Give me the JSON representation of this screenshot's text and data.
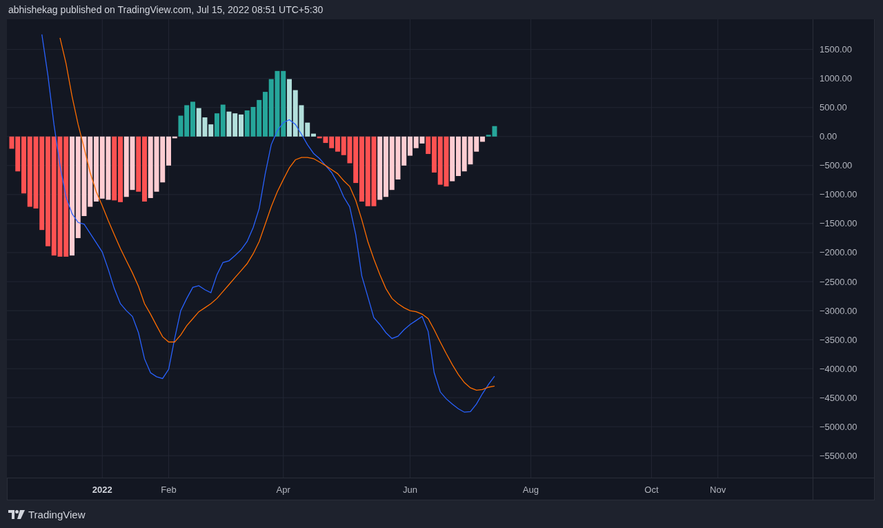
{
  "header": {
    "text": "abhishekag published on TradingView.com, Jul 15, 2022 08:51 UTC+5:30"
  },
  "histogram": {
    "chart_data": {
      "type": "bar",
      "categories": [
        null,
        null,
        null,
        null,
        null,
        null,
        null,
        null,
        null,
        null,
        null,
        null,
        null,
        null,
        null,
        "2022",
        null,
        null,
        null,
        null,
        null,
        null,
        null,
        null,
        null,
        null,
        "Feb",
        null,
        null,
        null,
        null,
        null,
        null,
        null,
        null,
        null,
        null,
        null,
        null,
        null,
        null,
        null,
        null,
        null,
        null,
        "Apr",
        null,
        null,
        null,
        null,
        null,
        null,
        null,
        null,
        null,
        null,
        null,
        null,
        null,
        null,
        null,
        null,
        null,
        null,
        null,
        null,
        "Jun",
        null,
        null,
        null,
        null,
        null,
        null,
        null,
        null,
        null,
        null,
        null,
        null,
        null,
        null,
        null,
        null,
        null,
        null,
        null,
        "Aug",
        null,
        null,
        null,
        null,
        null,
        null,
        null,
        null,
        null,
        null,
        null,
        null,
        null,
        null,
        null,
        null,
        null,
        null,
        null,
        "Oct",
        null,
        null,
        null,
        null,
        null,
        null,
        null,
        null,
        null,
        null,
        "Nov",
        null,
        null,
        null,
        null,
        null,
        null,
        null,
        null,
        null,
        null,
        null,
        null,
        null,
        null,
        null
      ],
      "ylim": [
        -6270,
        2020
      ],
      "yticks": [
        {
          "value": 1500,
          "label": "1500.00"
        },
        {
          "value": 1000,
          "label": "1000.00"
        },
        {
          "value": 500,
          "label": "500.00"
        },
        {
          "value": 0,
          "label": "0.00"
        },
        {
          "value": -500,
          "label": "−500.00"
        },
        {
          "value": -1000,
          "label": "−1000.00"
        },
        {
          "value": -1500,
          "label": "−1500.00"
        },
        {
          "value": -2000,
          "label": "−2000.00"
        },
        {
          "value": -2500,
          "label": "−2500.00"
        },
        {
          "value": -3000,
          "label": "−3000.00"
        },
        {
          "value": -3500,
          "label": "−3500.00"
        },
        {
          "value": -4000,
          "label": "−4000.00"
        },
        {
          "value": -4500,
          "label": "−4500.00"
        },
        {
          "value": -5000,
          "label": "−5000.00"
        },
        {
          "value": -5500,
          "label": "−5500.00"
        }
      ],
      "series": [
        {
          "color": "#ff5252",
          "values": [
            -210,
            -600,
            -980,
            -1210,
            -1240,
            -1610,
            -1890,
            -2050,
            -2070,
            -2070,
            null,
            null,
            null,
            null,
            null,
            null,
            null,
            -1100,
            -1130,
            null,
            null,
            -950,
            -1120,
            null,
            null,
            null,
            null,
            null,
            null,
            null,
            null,
            null,
            null,
            null,
            null,
            null,
            null,
            null,
            null,
            null,
            null,
            null,
            null,
            null,
            null,
            null,
            null,
            null,
            null,
            null,
            null,
            -30,
            -110,
            -200,
            -260,
            -320,
            -460,
            -800,
            -1120,
            -1200,
            -1200,
            null,
            null,
            null,
            null,
            null,
            null,
            null,
            null,
            -300,
            -620,
            -830,
            -860,
            null,
            null,
            null,
            null,
            null,
            null,
            null,
            null,
            null,
            null,
            null,
            null,
            null,
            null,
            null,
            null,
            null,
            null,
            null,
            null,
            null,
            null,
            null,
            null,
            null,
            null,
            null,
            null,
            null,
            null,
            null,
            null,
            null,
            null,
            null,
            null,
            null,
            null,
            null,
            null,
            null,
            null,
            null,
            null,
            null,
            null,
            null,
            null,
            null,
            null,
            null,
            null,
            null,
            null,
            null,
            null,
            null,
            null,
            null,
            null
          ]
        },
        {
          "color": "#ffcdd2",
          "values": [
            null,
            null,
            null,
            null,
            null,
            null,
            null,
            null,
            null,
            null,
            -2050,
            -1750,
            -1370,
            -1210,
            -1120,
            -1070,
            -1090,
            null,
            null,
            -1040,
            -920,
            null,
            null,
            -1060,
            -950,
            -790,
            -500,
            -30,
            null,
            null,
            null,
            null,
            null,
            null,
            null,
            null,
            null,
            null,
            null,
            null,
            null,
            null,
            null,
            null,
            null,
            null,
            null,
            null,
            null,
            null,
            null,
            null,
            null,
            null,
            null,
            null,
            null,
            null,
            null,
            null,
            null,
            -1090,
            -1040,
            -920,
            -740,
            -500,
            -330,
            -200,
            -120,
            null,
            null,
            null,
            null,
            -770,
            -680,
            -600,
            -480,
            -260,
            -90,
            null,
            null,
            null,
            null,
            null,
            null,
            null,
            null,
            null,
            null,
            null,
            null,
            null,
            null,
            null,
            null,
            null,
            null,
            null,
            null,
            null,
            null,
            null,
            null,
            null,
            null,
            null,
            null,
            null,
            null,
            null,
            null,
            null,
            null,
            null,
            null,
            null,
            null,
            null,
            null,
            null,
            null,
            null,
            null,
            null,
            null,
            null,
            null,
            null,
            null,
            null,
            null,
            null,
            null
          ]
        },
        {
          "color": "#26a69a",
          "values": [
            null,
            null,
            null,
            null,
            null,
            null,
            null,
            null,
            null,
            null,
            null,
            null,
            null,
            null,
            null,
            null,
            null,
            null,
            null,
            null,
            null,
            null,
            null,
            null,
            null,
            null,
            null,
            null,
            360,
            540,
            600,
            null,
            null,
            null,
            400,
            550,
            null,
            null,
            null,
            450,
            510,
            630,
            770,
            990,
            1130,
            1130,
            null,
            null,
            null,
            null,
            null,
            null,
            null,
            null,
            null,
            null,
            null,
            null,
            null,
            null,
            null,
            null,
            null,
            null,
            null,
            null,
            null,
            null,
            null,
            null,
            null,
            null,
            null,
            null,
            null,
            null,
            null,
            null,
            null,
            30,
            180,
            null,
            null,
            null,
            null,
            null,
            null,
            null,
            null,
            null,
            null,
            null,
            null,
            null,
            null,
            null,
            null,
            null,
            null,
            null,
            null,
            null,
            null,
            null,
            null,
            null,
            null,
            null,
            null,
            null,
            null,
            null,
            null,
            null,
            null,
            null,
            null,
            null,
            null,
            null,
            null,
            null,
            null,
            null,
            null,
            null,
            null,
            null,
            null,
            null,
            null,
            null,
            null
          ]
        },
        {
          "color": "#b2dfdb",
          "values": [
            null,
            null,
            null,
            null,
            null,
            null,
            null,
            null,
            null,
            null,
            null,
            null,
            null,
            null,
            null,
            null,
            null,
            null,
            null,
            null,
            null,
            null,
            null,
            null,
            null,
            null,
            null,
            null,
            null,
            null,
            null,
            490,
            330,
            210,
            null,
            null,
            430,
            400,
            380,
            null,
            null,
            null,
            null,
            null,
            null,
            null,
            990,
            800,
            540,
            240,
            50,
            null,
            null,
            null,
            null,
            null,
            null,
            null,
            null,
            null,
            null,
            null,
            null,
            null,
            null,
            null,
            null,
            null,
            null,
            null,
            null,
            null,
            null,
            null,
            null,
            null,
            null,
            null,
            null,
            null,
            null,
            null,
            null,
            null,
            null,
            null,
            null,
            null,
            null,
            null,
            null,
            null,
            null,
            null,
            null,
            null,
            null,
            null,
            null,
            null,
            null,
            null,
            null,
            null,
            null,
            null,
            null,
            null,
            null,
            null,
            null,
            null,
            null,
            null,
            null,
            null,
            null,
            null,
            null,
            null,
            null,
            null,
            null,
            null,
            null,
            null,
            null,
            null,
            null,
            null,
            null,
            null,
            null
          ]
        },
        {
          "type": "line",
          "color": "#2962ff",
          "values": [
            null,
            null,
            null,
            null,
            null,
            1760,
            1050,
            210,
            -500,
            -1040,
            -1330,
            -1480,
            -1510,
            -1670,
            -1830,
            -1990,
            -2290,
            -2620,
            -2880,
            -3000,
            -3100,
            -3380,
            -3830,
            -4070,
            -4140,
            -4170,
            -4010,
            -3480,
            -3000,
            -2790,
            -2600,
            -2570,
            -2640,
            -2690,
            -2380,
            -2170,
            -2140,
            -2050,
            -1950,
            -1810,
            -1570,
            -1240,
            -640,
            -140,
            100,
            240,
            290,
            210,
            40,
            -140,
            -290,
            -380,
            -500,
            -620,
            -800,
            -1040,
            -1210,
            -1690,
            -2400,
            -2760,
            -3120,
            -3240,
            -3380,
            -3480,
            -3440,
            -3330,
            -3240,
            -3170,
            -3100,
            -3360,
            -4070,
            -4400,
            -4520,
            -4610,
            -4690,
            -4750,
            -4740,
            -4610,
            -4430,
            -4270,
            -4130,
            null,
            null,
            null,
            null,
            null,
            null,
            null,
            null,
            null,
            null,
            null,
            null,
            null,
            null,
            null,
            null,
            null,
            null,
            null,
            null,
            null,
            null,
            null,
            null,
            null,
            null,
            null,
            null,
            null,
            null,
            null,
            null,
            null,
            null,
            null,
            null,
            null,
            null,
            null,
            null,
            null,
            null,
            null,
            null,
            null,
            null,
            null,
            null,
            null,
            null,
            null,
            null
          ]
        },
        {
          "type": "line",
          "color": "#ff6d00",
          "values": [
            null,
            null,
            null,
            null,
            null,
            null,
            null,
            null,
            1700,
            1260,
            690,
            210,
            -200,
            -620,
            -950,
            -1190,
            -1450,
            -1690,
            -1930,
            -2140,
            -2350,
            -2580,
            -2880,
            -3060,
            -3260,
            -3450,
            -3540,
            -3540,
            -3420,
            -3260,
            -3140,
            -3020,
            -2950,
            -2880,
            -2790,
            -2670,
            -2550,
            -2430,
            -2310,
            -2190,
            -2020,
            -1810,
            -1510,
            -1210,
            -950,
            -740,
            -540,
            -400,
            -360,
            -360,
            -380,
            -440,
            -500,
            -570,
            -640,
            -760,
            -860,
            -1100,
            -1430,
            -1810,
            -2110,
            -2380,
            -2620,
            -2790,
            -2880,
            -2950,
            -3000,
            -3020,
            -3060,
            -3140,
            -3330,
            -3540,
            -3740,
            -3930,
            -4100,
            -4240,
            -4330,
            -4370,
            -4360,
            -4320,
            -4300,
            null,
            null,
            null,
            null,
            null,
            null,
            null,
            null,
            null,
            null,
            null,
            null,
            null,
            null,
            null,
            null,
            null,
            null,
            null,
            null,
            null,
            null,
            null,
            null,
            null,
            null,
            null,
            null,
            null,
            null,
            null,
            null,
            null,
            null,
            null,
            null,
            null,
            null,
            null,
            null,
            null,
            null,
            null,
            null,
            null,
            null,
            null,
            null,
            null,
            null,
            null,
            null
          ]
        }
      ]
    }
  },
  "footer": {
    "brand": "TradingView"
  }
}
